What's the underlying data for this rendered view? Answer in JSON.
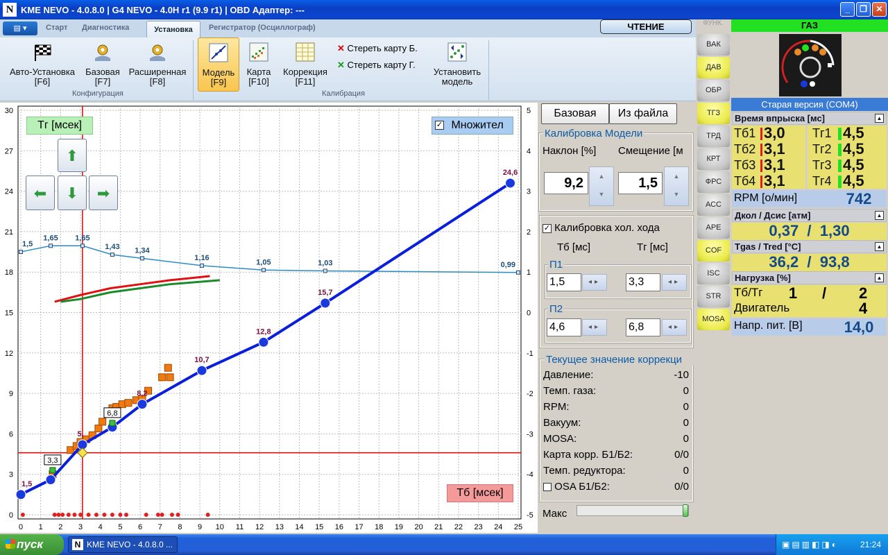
{
  "window": {
    "title": "KME NEVO - 4.0.8.0  |  G4 NEVO - 4.0H r1 (9.9 r1)  |  OBD Адаптер: ---",
    "logo": "N"
  },
  "ribbon": {
    "tabs": [
      "Старт",
      "Диагностика",
      "Установка",
      "Регистратор (Осциллограф)"
    ],
    "active_tab": "Установка",
    "read_button": "ЧТЕНИЕ",
    "buttons": [
      {
        "label": "Авто-Установка",
        "key": "[F6]"
      },
      {
        "label": "Базовая",
        "key": "[F7]"
      },
      {
        "label": "Расширенная",
        "key": "[F8]"
      },
      {
        "label": "Модель",
        "key": "[F9]"
      },
      {
        "label": "Карта",
        "key": "[F10]"
      },
      {
        "label": "Коррекция",
        "key": "[F11]"
      },
      {
        "label": "Установить",
        "key": "модель"
      }
    ],
    "erase_b": "Стереть карту Б.",
    "erase_g": "Стереть карту Г.",
    "group_config": "Конфигурация",
    "group_calib": "Калибрация"
  },
  "chart_data": {
    "type": "scatter",
    "xlabel": "Тб [мсек]",
    "ylabel": "Тг [мсек]",
    "xlim": [
      0,
      25
    ],
    "ylim_left": [
      0,
      30
    ],
    "ylim_right": [
      -5,
      5
    ],
    "x_ticks": [
      "0",
      "1",
      "2",
      "3",
      "4",
      "5",
      "6",
      "7",
      "8",
      "9",
      "10",
      "11",
      "12",
      "13",
      "14",
      "15",
      "16",
      "17",
      "18",
      "19",
      "20",
      "21",
      "22",
      "23",
      "24",
      "25"
    ],
    "y_ticks_left": [
      "0",
      "3",
      "6",
      "9",
      "12",
      "15",
      "18",
      "21",
      "24",
      "27",
      "30"
    ],
    "y_ticks_right": [
      "-5",
      "-4",
      "-3",
      "-2",
      "-1",
      "0",
      "1",
      "2",
      "3",
      "4",
      "5"
    ],
    "model_curve": {
      "x": [
        0,
        1.5,
        3.1,
        4.6,
        6.1,
        9.1,
        12.2,
        15.3,
        24.6
      ],
      "y": [
        1.5,
        2.6,
        5.2,
        6.5,
        8.2,
        10.7,
        12.8,
        15.7,
        24.6
      ]
    },
    "model_labels": [
      {
        "x": 0,
        "y": 1.5,
        "text": "1,5"
      },
      {
        "x": 3.0,
        "y": 5.2,
        "text": "5,"
      },
      {
        "x": 6.1,
        "y": 8.2,
        "text": "8,2"
      },
      {
        "x": 9.1,
        "y": 10.7,
        "text": "10,7"
      },
      {
        "x": 12.2,
        "y": 12.8,
        "text": "12,8"
      },
      {
        "x": 15.3,
        "y": 15.7,
        "text": "15,7"
      },
      {
        "x": 24.6,
        "y": 24.6,
        "text": "24,6"
      }
    ],
    "multiplier_curve": {
      "x": [
        0,
        1.5,
        3.1,
        4.6,
        6.1,
        9.1,
        12.2,
        15.3,
        25
      ],
      "y": [
        1.5,
        1.65,
        1.65,
        1.43,
        1.34,
        1.16,
        1.05,
        1.03,
        0.99
      ]
    },
    "multiplier_labels": [
      "1,5",
      "1,65",
      "1,65",
      "1,43",
      "1,34",
      "1,16",
      "1,05",
      "1,03",
      "0,99"
    ],
    "red_trend": {
      "x": [
        1.7,
        3,
        4.5,
        6,
        7.5,
        9.5
      ],
      "y": [
        15.8,
        16.3,
        16.8,
        17.1,
        17.4,
        17.7
      ]
    },
    "green_trend": {
      "x": [
        2.0,
        3,
        4.5,
        6,
        7.5,
        10.0
      ],
      "y": [
        15.8,
        16.0,
        16.5,
        16.8,
        17.1,
        17.4
      ]
    },
    "orange_points": {
      "x": [
        1.6,
        2.5,
        2.8,
        3.0,
        3.3,
        3.6,
        3.9,
        4.1,
        4.4,
        4.6,
        4.8,
        5.1,
        5.4,
        5.8,
        6.1,
        6.4,
        7.1,
        7.4,
        7.5
      ],
      "y": [
        3.0,
        4.8,
        5.1,
        5.4,
        5.6,
        5.9,
        6.4,
        6.9,
        7.5,
        7.9,
        8.0,
        8.2,
        8.3,
        8.5,
        8.6,
        9.2,
        10.2,
        10.9,
        10.2
      ]
    },
    "zero_points_x": [
      0.1,
      1.7,
      1.9,
      2.1,
      2.4,
      2.7,
      3.0,
      3.4,
      3.8,
      4.2,
      4.6,
      5.0,
      5.3,
      6.3,
      6.9,
      7.1,
      7.6,
      7.9,
      9.4
    ],
    "green_markers": [
      {
        "x": 1.6,
        "y": 3.3,
        "text": "3,3"
      },
      {
        "x": 4.6,
        "y": 6.8,
        "text": "6,8"
      }
    ],
    "cursor": {
      "x": 3.1,
      "y": 4.6
    },
    "multiplier_checkbox": "Множител"
  },
  "calibration": {
    "btn_base": "Базовая",
    "btn_file": "Из файла",
    "model_title": "Калибровка Модели",
    "slope_label": "Наклон [%]",
    "offset_label": "Смещение [м",
    "slope_value": "9,2",
    "offset_value": "1,5",
    "idle_check": "Калибровка хол. хода",
    "tb_col": "Тб [мс]",
    "tg_col": "Тг [мс]",
    "p1_label": "П1",
    "p1_tb": "1,5",
    "p1_tg": "3,3",
    "p2_label": "П2",
    "p2_tb": "4,6",
    "p2_tg": "6,8",
    "corr_title": "Текущее значение коррекци",
    "corrections": [
      {
        "label": "Давление:",
        "value": "-10"
      },
      {
        "label": "Темп. газа:",
        "value": "0"
      },
      {
        "label": "RPM:",
        "value": "0"
      },
      {
        "label": "Вакуум:",
        "value": "0"
      },
      {
        "label": "MOSA:",
        "value": "0"
      },
      {
        "label": "Карта корр. Б1/Б2:",
        "value": "0/0"
      },
      {
        "label": "Темп. редуктора:",
        "value": "0"
      },
      {
        "label": "OSA Б1/Б2:",
        "value": "0/0"
      }
    ],
    "max_label": "Макс"
  },
  "func": {
    "header": "ФУНК.",
    "buttons": [
      {
        "label": "ВАК",
        "on": false
      },
      {
        "label": "ДАВ",
        "on": true
      },
      {
        "label": "ОБР",
        "on": false
      },
      {
        "label": "ТГЗ",
        "on": true
      },
      {
        "label": "ТРД",
        "on": false
      },
      {
        "label": "КРТ",
        "on": false
      },
      {
        "label": "ФРС",
        "on": false
      },
      {
        "label": "АСС",
        "on": false
      },
      {
        "label": "АРЕ",
        "on": false
      },
      {
        "label": "COF",
        "on": true
      },
      {
        "label": "ISC",
        "on": false
      },
      {
        "label": "STR",
        "on": false
      },
      {
        "label": "MOSA",
        "on": true
      }
    ]
  },
  "status": {
    "gas_label": "ГАЗ",
    "version": "Старая версия (COM4)",
    "injection_title": "Время впрыска [мс]",
    "tb": [
      {
        "l": "Тб1",
        "v": "3,0"
      },
      {
        "l": "Тб2",
        "v": "3,1"
      },
      {
        "l": "Тб3",
        "v": "3,1"
      },
      {
        "l": "Тб4",
        "v": "3,1"
      }
    ],
    "tg": [
      {
        "l": "Тг1",
        "v": "4,5"
      },
      {
        "l": "Тг2",
        "v": "4,5"
      },
      {
        "l": "Тг3",
        "v": "4,5"
      },
      {
        "l": "Тг4",
        "v": "4,5"
      }
    ],
    "rpm_label": "RPM [о/мин]",
    "rpm_value": "742",
    "pressure_title": "Дкол / Дсис [атм]",
    "pressure_value": "0,37  /  1,30",
    "temp_title": "Tgas / Tred [°C]",
    "temp_value": "36,2  /  93,8",
    "load_title": "Нагрузка [%]",
    "load_label": "Тб/Тг",
    "load_a": "1",
    "load_sep": "/",
    "load_b": "2",
    "engine_label": "Двигатель",
    "engine_value": "4",
    "voltage_label": "Напр. пит. [В]",
    "voltage_value": "14,0"
  },
  "taskbar": {
    "start": "пуск",
    "task": "KME NEVO - 4.0.8.0 ...",
    "time": "21:24"
  },
  "colors": {
    "model": "#0a1fdc",
    "multiplier": "#2b8bc4",
    "cursor": "#e00000",
    "accent_yellow": "#e8e070",
    "green_bar": "#22e022"
  }
}
